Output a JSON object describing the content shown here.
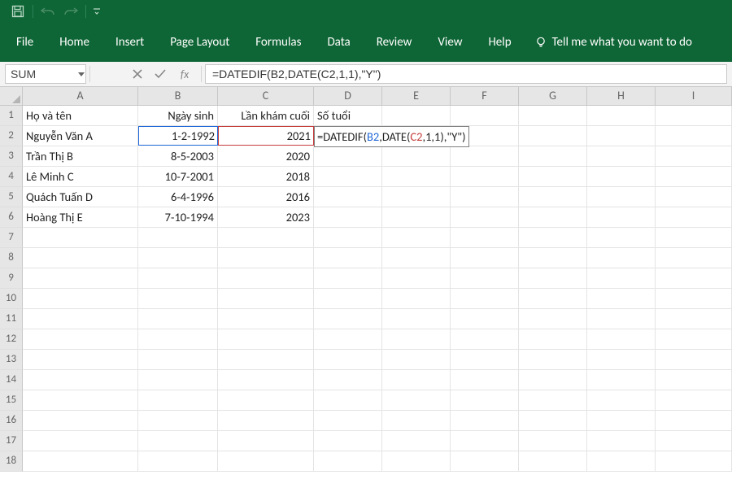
{
  "qat": {
    "save_icon": "save-icon",
    "undo_icon": "undo-icon",
    "redo_icon": "redo-icon",
    "customize_icon": "chevron-down-icon"
  },
  "ribbon": {
    "file": "File",
    "tabs": [
      "Home",
      "Insert",
      "Page Layout",
      "Formulas",
      "Data",
      "Review",
      "View",
      "Help"
    ],
    "tell_me": "Tell me what you want to do"
  },
  "namebox": {
    "value": "SUM"
  },
  "formula_bar": {
    "fx_label": "fx",
    "value": "=DATEDIF(B2,DATE(C2,1,1),\"Y\")"
  },
  "columns": [
    "A",
    "B",
    "C",
    "D",
    "E",
    "F",
    "G",
    "H",
    "I"
  ],
  "row_count": 18,
  "grid": {
    "headers": {
      "A1": "Họ và tên",
      "B1": "Ngày sinh",
      "C1": "Lần khám cuối",
      "D1": "Số tuổi"
    },
    "rows": [
      {
        "name": "Nguyễn Văn A",
        "dob": "1-2-1992",
        "year": "2021"
      },
      {
        "name": "Trần Thị B",
        "dob": "8-5-2003",
        "year": "2020"
      },
      {
        "name": "Lê Minh C",
        "dob": "10-7-2001",
        "year": "2018"
      },
      {
        "name": "Quách Tuấn D",
        "dob": "6-4-1996",
        "year": "2016"
      },
      {
        "name": "Hoàng Thị E",
        "dob": "7-10-1994",
        "year": "2023"
      }
    ],
    "editing_cell": "D2",
    "editing_formula_parts": {
      "p1": "=DATEDIF(",
      "ref_b": "B2",
      "p2": ",DATE(",
      "ref_c": "C2",
      "p3": ",1,1),\"Y\")"
    }
  }
}
